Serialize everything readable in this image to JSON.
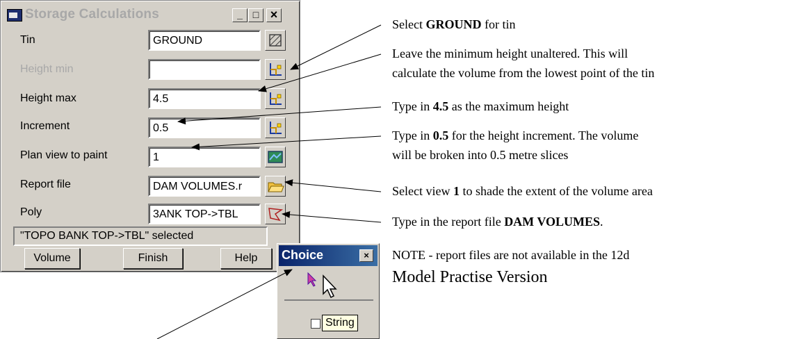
{
  "dialog": {
    "title": "Storage Calculations",
    "controls": {
      "minimize": "_",
      "maximize": "□",
      "close": "×"
    },
    "rows": [
      {
        "label": "Tin",
        "value": "GROUND",
        "button_icon": "tin-pick-icon",
        "enabled": true
      },
      {
        "label": "Height min",
        "value": "",
        "button_icon": "height-pick-icon",
        "enabled": false
      },
      {
        "label": "Height max",
        "value": "4.5",
        "button_icon": "height-pick-icon",
        "enabled": true
      },
      {
        "label": "Increment",
        "value": "0.5",
        "button_icon": "height-pick-icon",
        "enabled": true
      },
      {
        "label": "Plan view to paint",
        "value": "1",
        "button_icon": "view-icon",
        "enabled": true
      },
      {
        "label": "Report file",
        "value": "DAM VOLUMES.r",
        "button_icon": "folder-icon",
        "enabled": true
      },
      {
        "label": "Poly",
        "value": "3ANK TOP->TBL",
        "button_icon": "polygon-pick-icon",
        "enabled": true
      }
    ],
    "status": "\"TOPO BANK TOP->TBL\" selected",
    "buttons": {
      "volume": "Volume",
      "finish": "Finish",
      "help": "Help"
    }
  },
  "choice_popup": {
    "title": "Choice",
    "close": "×",
    "tooltip": "String"
  },
  "annotations": {
    "tin": {
      "pre": "Select ",
      "bold": "GROUND",
      "post": " for tin"
    },
    "height_min_1": "Leave the minimum height unaltered. This will",
    "height_min_2": "calculate the volume from the lowest point of the tin",
    "height_max": {
      "pre": "Type in ",
      "bold": "4.5",
      "post": " as the maximum height"
    },
    "increment_1": {
      "pre": "Type in ",
      "bold": "0.5",
      "post": " for the height increment. The volume"
    },
    "increment_2": "will be broken into 0.5 metre slices",
    "plan_view": {
      "pre": "Select view ",
      "bold": "1",
      "post": " to shade the extent of the volume area"
    },
    "report": {
      "pre": "Type in the report file ",
      "bold": "DAM VOLUMES",
      "post": "."
    },
    "note_1": "NOTE - report files are not available in the 12d",
    "note_2": "Model Practise Version"
  },
  "colors": {
    "dialog_bg": "#d4d0c8",
    "title_inactive": "#a8a8a8",
    "choice_title": "#0a246a"
  }
}
